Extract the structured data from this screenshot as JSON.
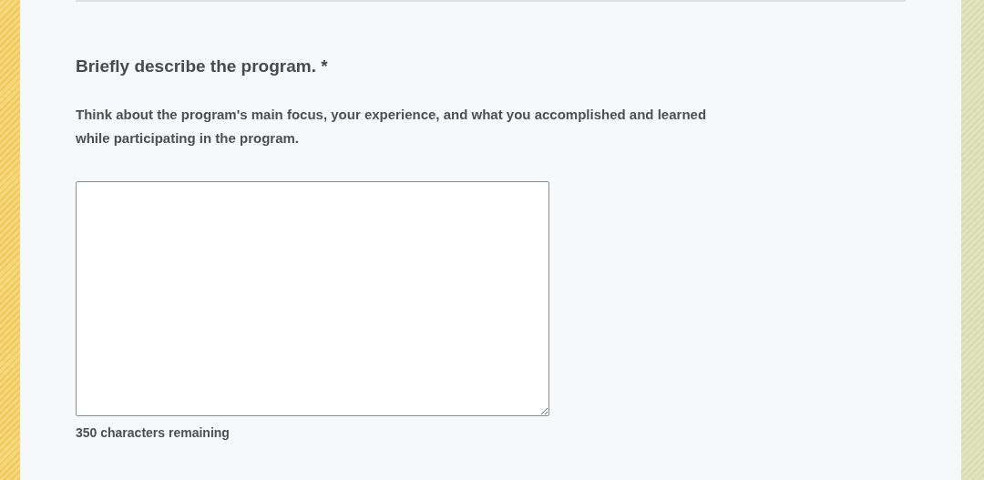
{
  "question": {
    "title": "Briefly describe the program. *",
    "description": "Think about the program's main focus, your experience, and what you accomplished and learned while participating in the program.",
    "counter": "350 characters remaining"
  }
}
